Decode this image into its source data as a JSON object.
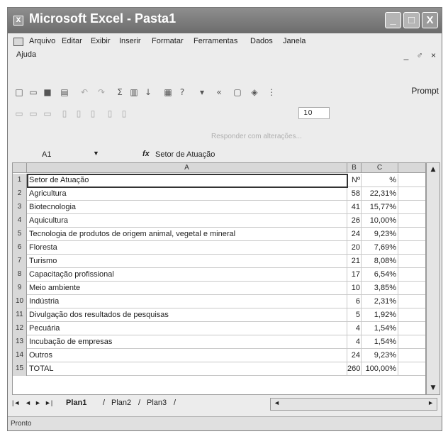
{
  "window": {
    "title": "Microsoft Excel - Pasta1",
    "controls": {
      "minimize": "_",
      "maximize": "□",
      "close": "X"
    }
  },
  "menubar": {
    "items": [
      "Arquivo",
      "Editar",
      "Exibir",
      "Inserir",
      "Formatar",
      "Ferramentas",
      "Dados",
      "Janela",
      "Ajuda"
    ],
    "mdi_controls": "_ ♂ ×"
  },
  "toolbar": {
    "prompt_label": "Prompt",
    "font_size": "10",
    "reply_text": "Responder com alterações..."
  },
  "formula_bar": {
    "name_box": "A1",
    "fx": "fx",
    "content": "Setor de Atuação"
  },
  "grid": {
    "columns": [
      "A",
      "B",
      "C"
    ],
    "rows": [
      {
        "n": "1",
        "a": "Setor de Atuação",
        "b": "Nº",
        "c": "%"
      },
      {
        "n": "2",
        "a": "Agricultura",
        "b": "58",
        "c": "22,31%"
      },
      {
        "n": "3",
        "a": "Biotecnologia",
        "b": "41",
        "c": "15,77%"
      },
      {
        "n": "4",
        "a": "Aquicultura",
        "b": "26",
        "c": "10,00%"
      },
      {
        "n": "5",
        "a": "Tecnologia de produtos de origem animal, vegetal e mineral",
        "b": "24",
        "c": "9,23%"
      },
      {
        "n": "6",
        "a": "Floresta",
        "b": "20",
        "c": "7,69%"
      },
      {
        "n": "7",
        "a": "Turismo",
        "b": "21",
        "c": "8,08%"
      },
      {
        "n": "8",
        "a": "Capacitação profissional",
        "b": "17",
        "c": "6,54%"
      },
      {
        "n": "9",
        "a": "Meio ambiente",
        "b": "10",
        "c": "3,85%"
      },
      {
        "n": "10",
        "a": "Indústria",
        "b": "6",
        "c": "2,31%"
      },
      {
        "n": "11",
        "a": "Divulgação dos resultados de pesquisas",
        "b": "5",
        "c": "1,92%"
      },
      {
        "n": "12",
        "a": "Pecuária",
        "b": "4",
        "c": "1,54%"
      },
      {
        "n": "13",
        "a": "Incubação de empresas",
        "b": "4",
        "c": "1,54%"
      },
      {
        "n": "14",
        "a": "Outros",
        "b": "24",
        "c": "9,23%"
      },
      {
        "n": "15",
        "a": "TOTAL",
        "b": "260",
        "c": "100,00%"
      }
    ]
  },
  "sheets": {
    "nav": [
      "|◄",
      "◄",
      "►",
      "►|"
    ],
    "tabs": [
      "Plan1",
      "Plan2",
      "Plan3"
    ]
  },
  "status": {
    "text": "Pronto"
  }
}
